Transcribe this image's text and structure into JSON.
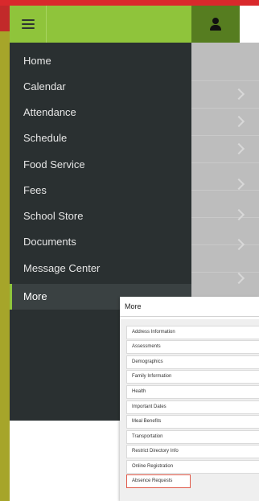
{
  "header": {
    "menu_icon": "hamburger-menu-icon",
    "user_icon": "user-icon"
  },
  "nav": {
    "items": [
      {
        "label": "Home"
      },
      {
        "label": "Calendar"
      },
      {
        "label": "Attendance"
      },
      {
        "label": "Schedule"
      },
      {
        "label": "Food Service"
      },
      {
        "label": "Fees"
      },
      {
        "label": "School Store"
      },
      {
        "label": "Documents"
      },
      {
        "label": "Message Center"
      },
      {
        "label": "More",
        "active": true
      }
    ]
  },
  "more_menu": {
    "title": "More",
    "items": [
      {
        "label": "Address Information"
      },
      {
        "label": "Assessments"
      },
      {
        "label": "Demographics"
      },
      {
        "label": "Family Information"
      },
      {
        "label": "Health"
      },
      {
        "label": "Important Dates"
      },
      {
        "label": "Meal Benefits"
      },
      {
        "label": "Transportation"
      },
      {
        "label": "Restrict Directory Info"
      },
      {
        "label": "Online Registration"
      },
      {
        "label": "Absence Requests",
        "highlighted": true
      }
    ]
  },
  "colors": {
    "header_green": "#8fc43b",
    "header_dark_green": "#567d20",
    "nav_background": "#2a3031",
    "top_bar_red": "#d9292c",
    "highlight_border": "#e05a4a"
  }
}
